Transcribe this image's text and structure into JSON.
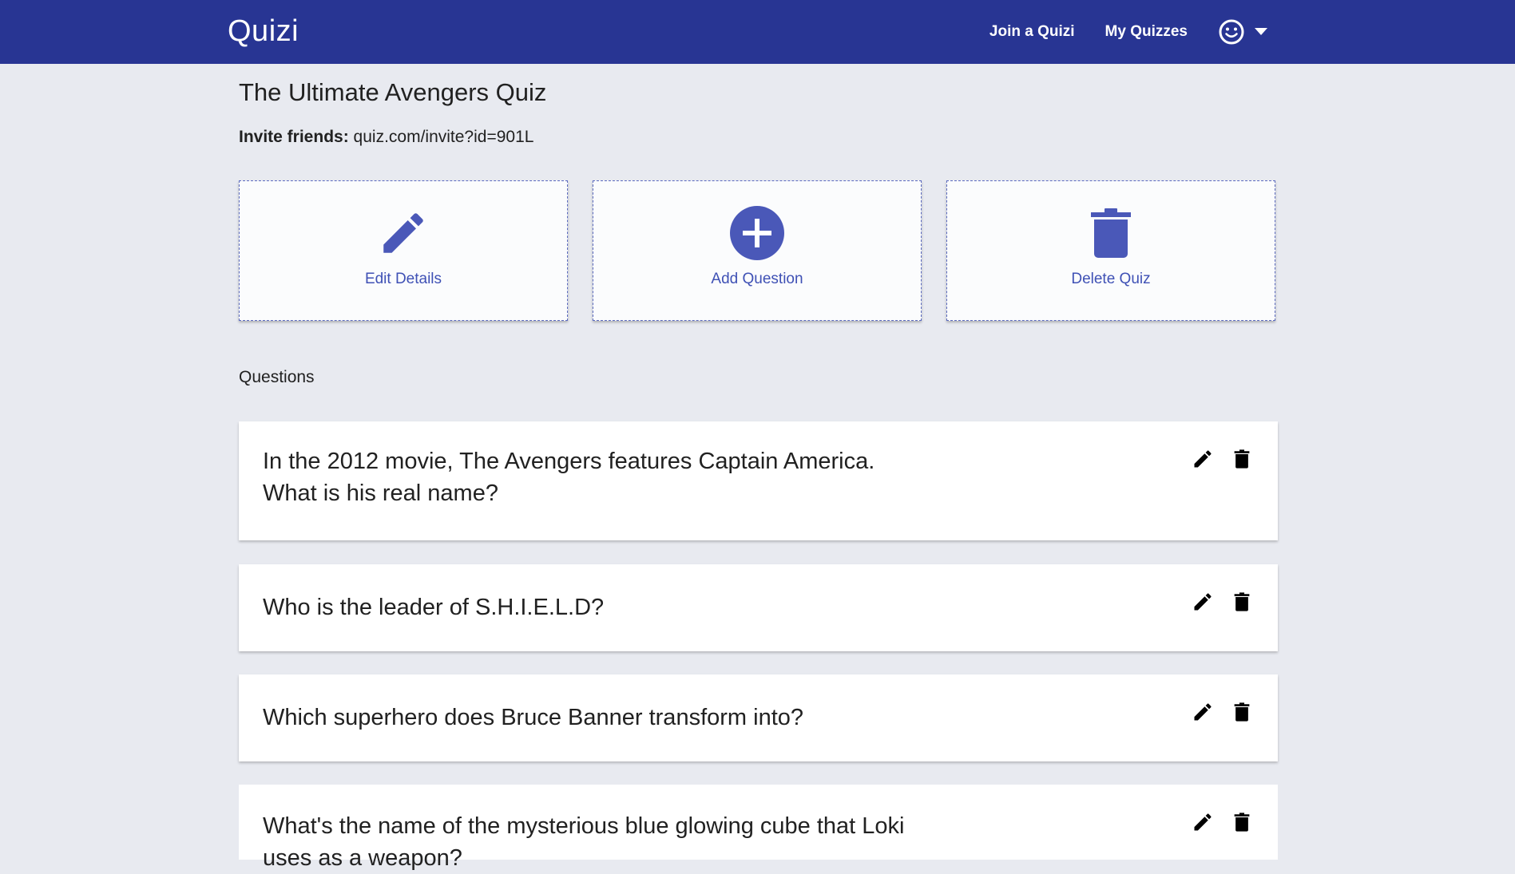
{
  "app": {
    "brand": "Quizi"
  },
  "nav": {
    "join_label": "Join a Quizi",
    "my_quizzes_label": "My Quizzes",
    "account_icon": "smiley-face-icon",
    "dropdown_icon": "caret-down-icon"
  },
  "quiz": {
    "title": "The Ultimate Avengers Quiz",
    "invite_label": "Invite friends:",
    "invite_link": "quiz.com/invite?id=901L"
  },
  "actions": [
    {
      "label": "Edit Details",
      "icon": "pencil-icon"
    },
    {
      "label": "Add Question",
      "icon": "plus-circle-icon"
    },
    {
      "label": "Delete Quiz",
      "icon": "trash-icon"
    }
  ],
  "questions_heading": "Questions",
  "questions": [
    {
      "text": "In the 2012 movie, The Avengers features Captain America. What is his real name?"
    },
    {
      "text": "Who is the leader of S.H.I.E.L.D?"
    },
    {
      "text": "Which superhero does Bruce Banner transform into?"
    },
    {
      "text": "What's the name of the mysterious blue glowing cube that Loki uses as a weapon?"
    }
  ],
  "colors": {
    "navbar": "#283593",
    "accent": "#3f51b5",
    "background": "#e8eaf0"
  }
}
